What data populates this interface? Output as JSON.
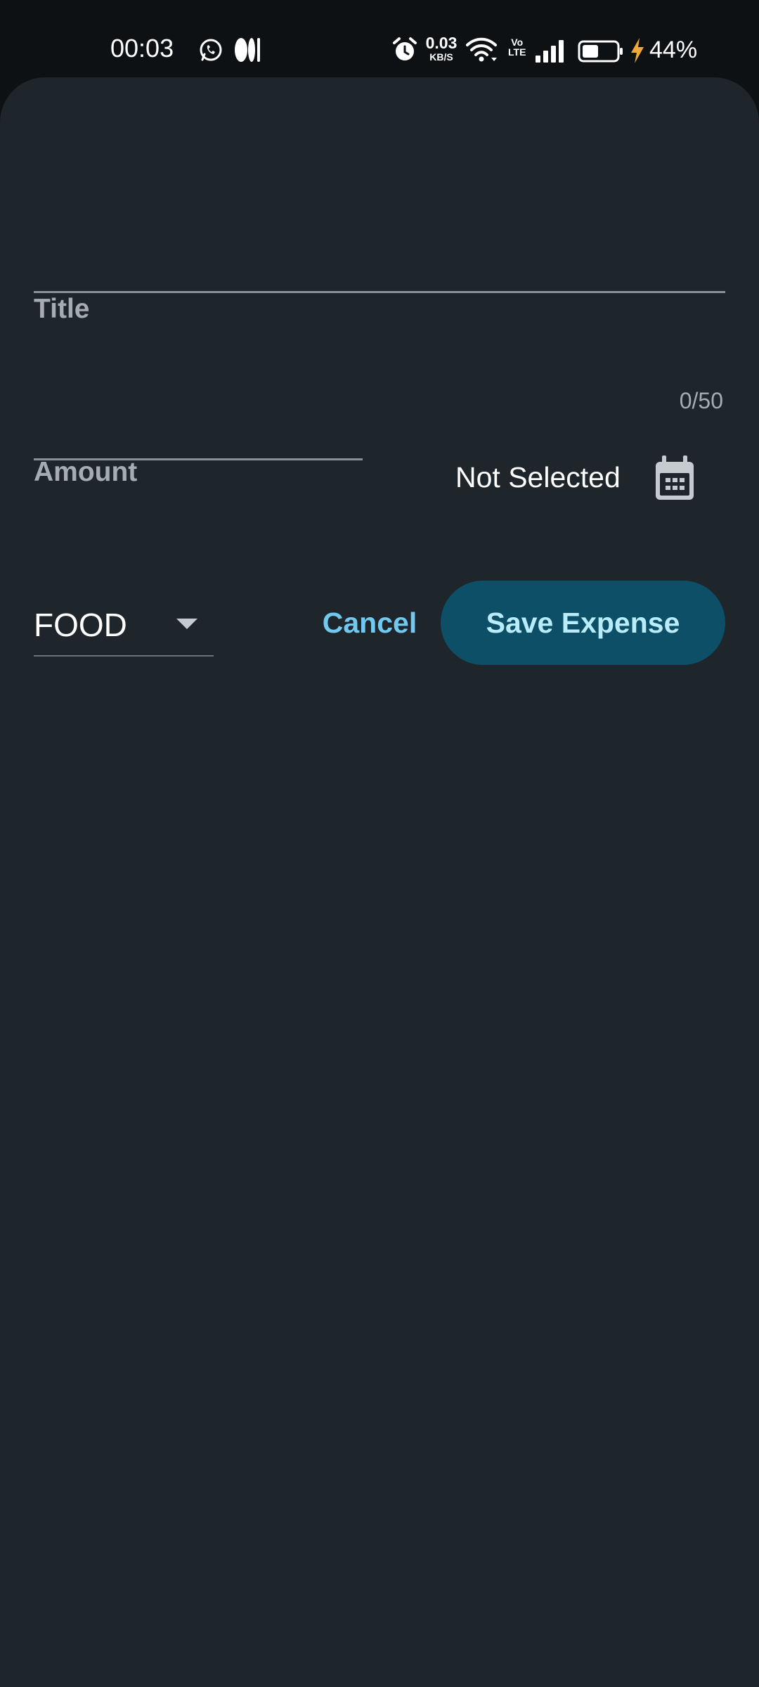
{
  "status_bar": {
    "time": "00:03",
    "speed_value": "0.03",
    "speed_unit": "KB/S",
    "volte_top": "Vo",
    "volte_bottom": "LTE",
    "battery_percent": "44%",
    "icons": [
      "whatsapp-icon",
      "media-icon",
      "alarm-icon",
      "wifi-icon",
      "signal-icon",
      "battery-icon",
      "charging-icon"
    ]
  },
  "form": {
    "title_label": "Title",
    "title_value": "",
    "title_counter": "0/50",
    "amount_label": "Amount",
    "amount_value": "",
    "date_text": "Not Selected",
    "category_value": "FOOD",
    "cancel_label": "Cancel",
    "save_label": "Save Expense"
  },
  "colors": {
    "background": "#1e252b",
    "status_bar": "#0e1113",
    "accent": "#72c9ef",
    "save_button": "#0c4f66",
    "save_text": "#b9ecfb"
  }
}
